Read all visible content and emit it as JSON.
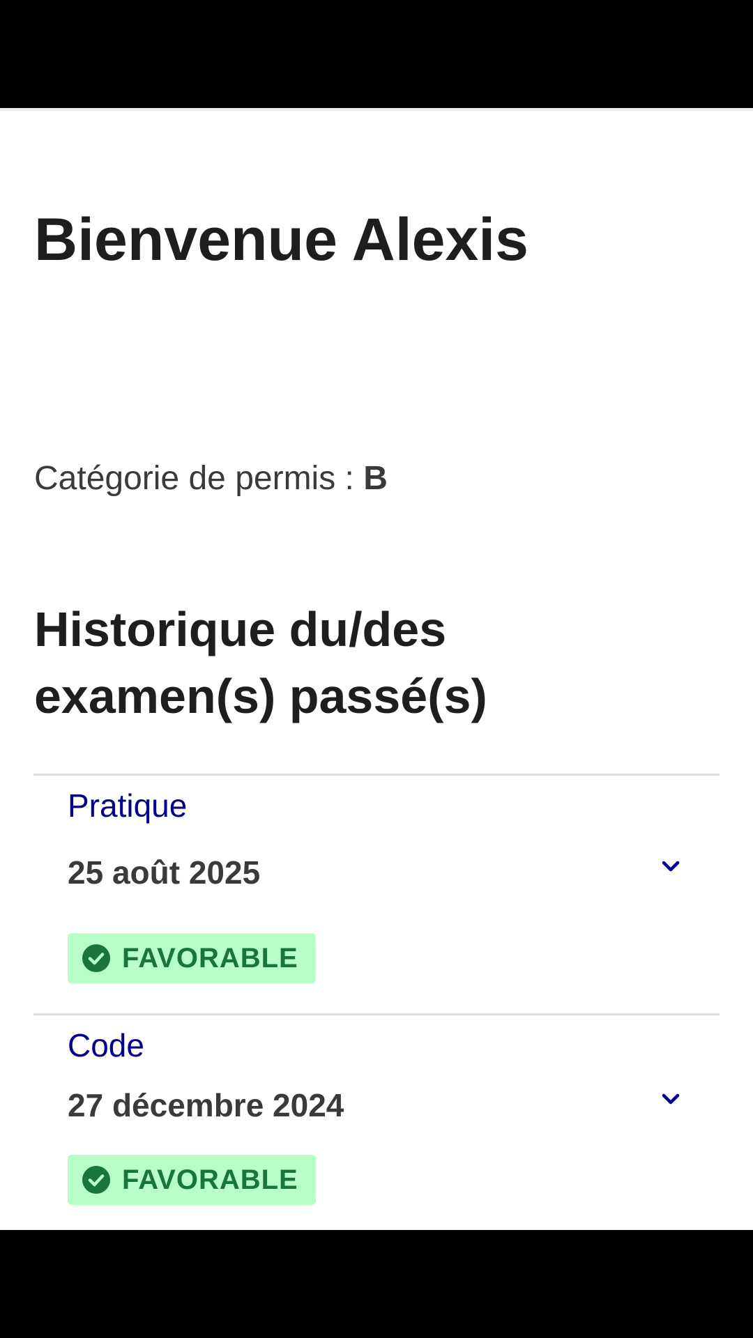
{
  "header": {
    "welcome_title": "Bienvenue Alexis"
  },
  "license": {
    "label": "Catégorie de permis : ",
    "value": "B"
  },
  "history": {
    "title": "Historique du/des examen(s) passé(s)",
    "exams": [
      {
        "type": "Pratique",
        "date": "25 août 2025",
        "status": "FAVORABLE",
        "status_icon": "check-circle-icon",
        "expand_icon": "chevron-down-icon"
      },
      {
        "type": "Code",
        "date": "27 décembre 2024",
        "status": "FAVORABLE",
        "status_icon": "check-circle-icon",
        "expand_icon": "chevron-down-icon"
      }
    ]
  },
  "colors": {
    "type_label": "#000091",
    "badge_background": "#b8fec9",
    "badge_text": "#18753c",
    "heading_text": "#1e1e1e",
    "body_text": "#3a3a3a",
    "divider": "#dddddd"
  }
}
